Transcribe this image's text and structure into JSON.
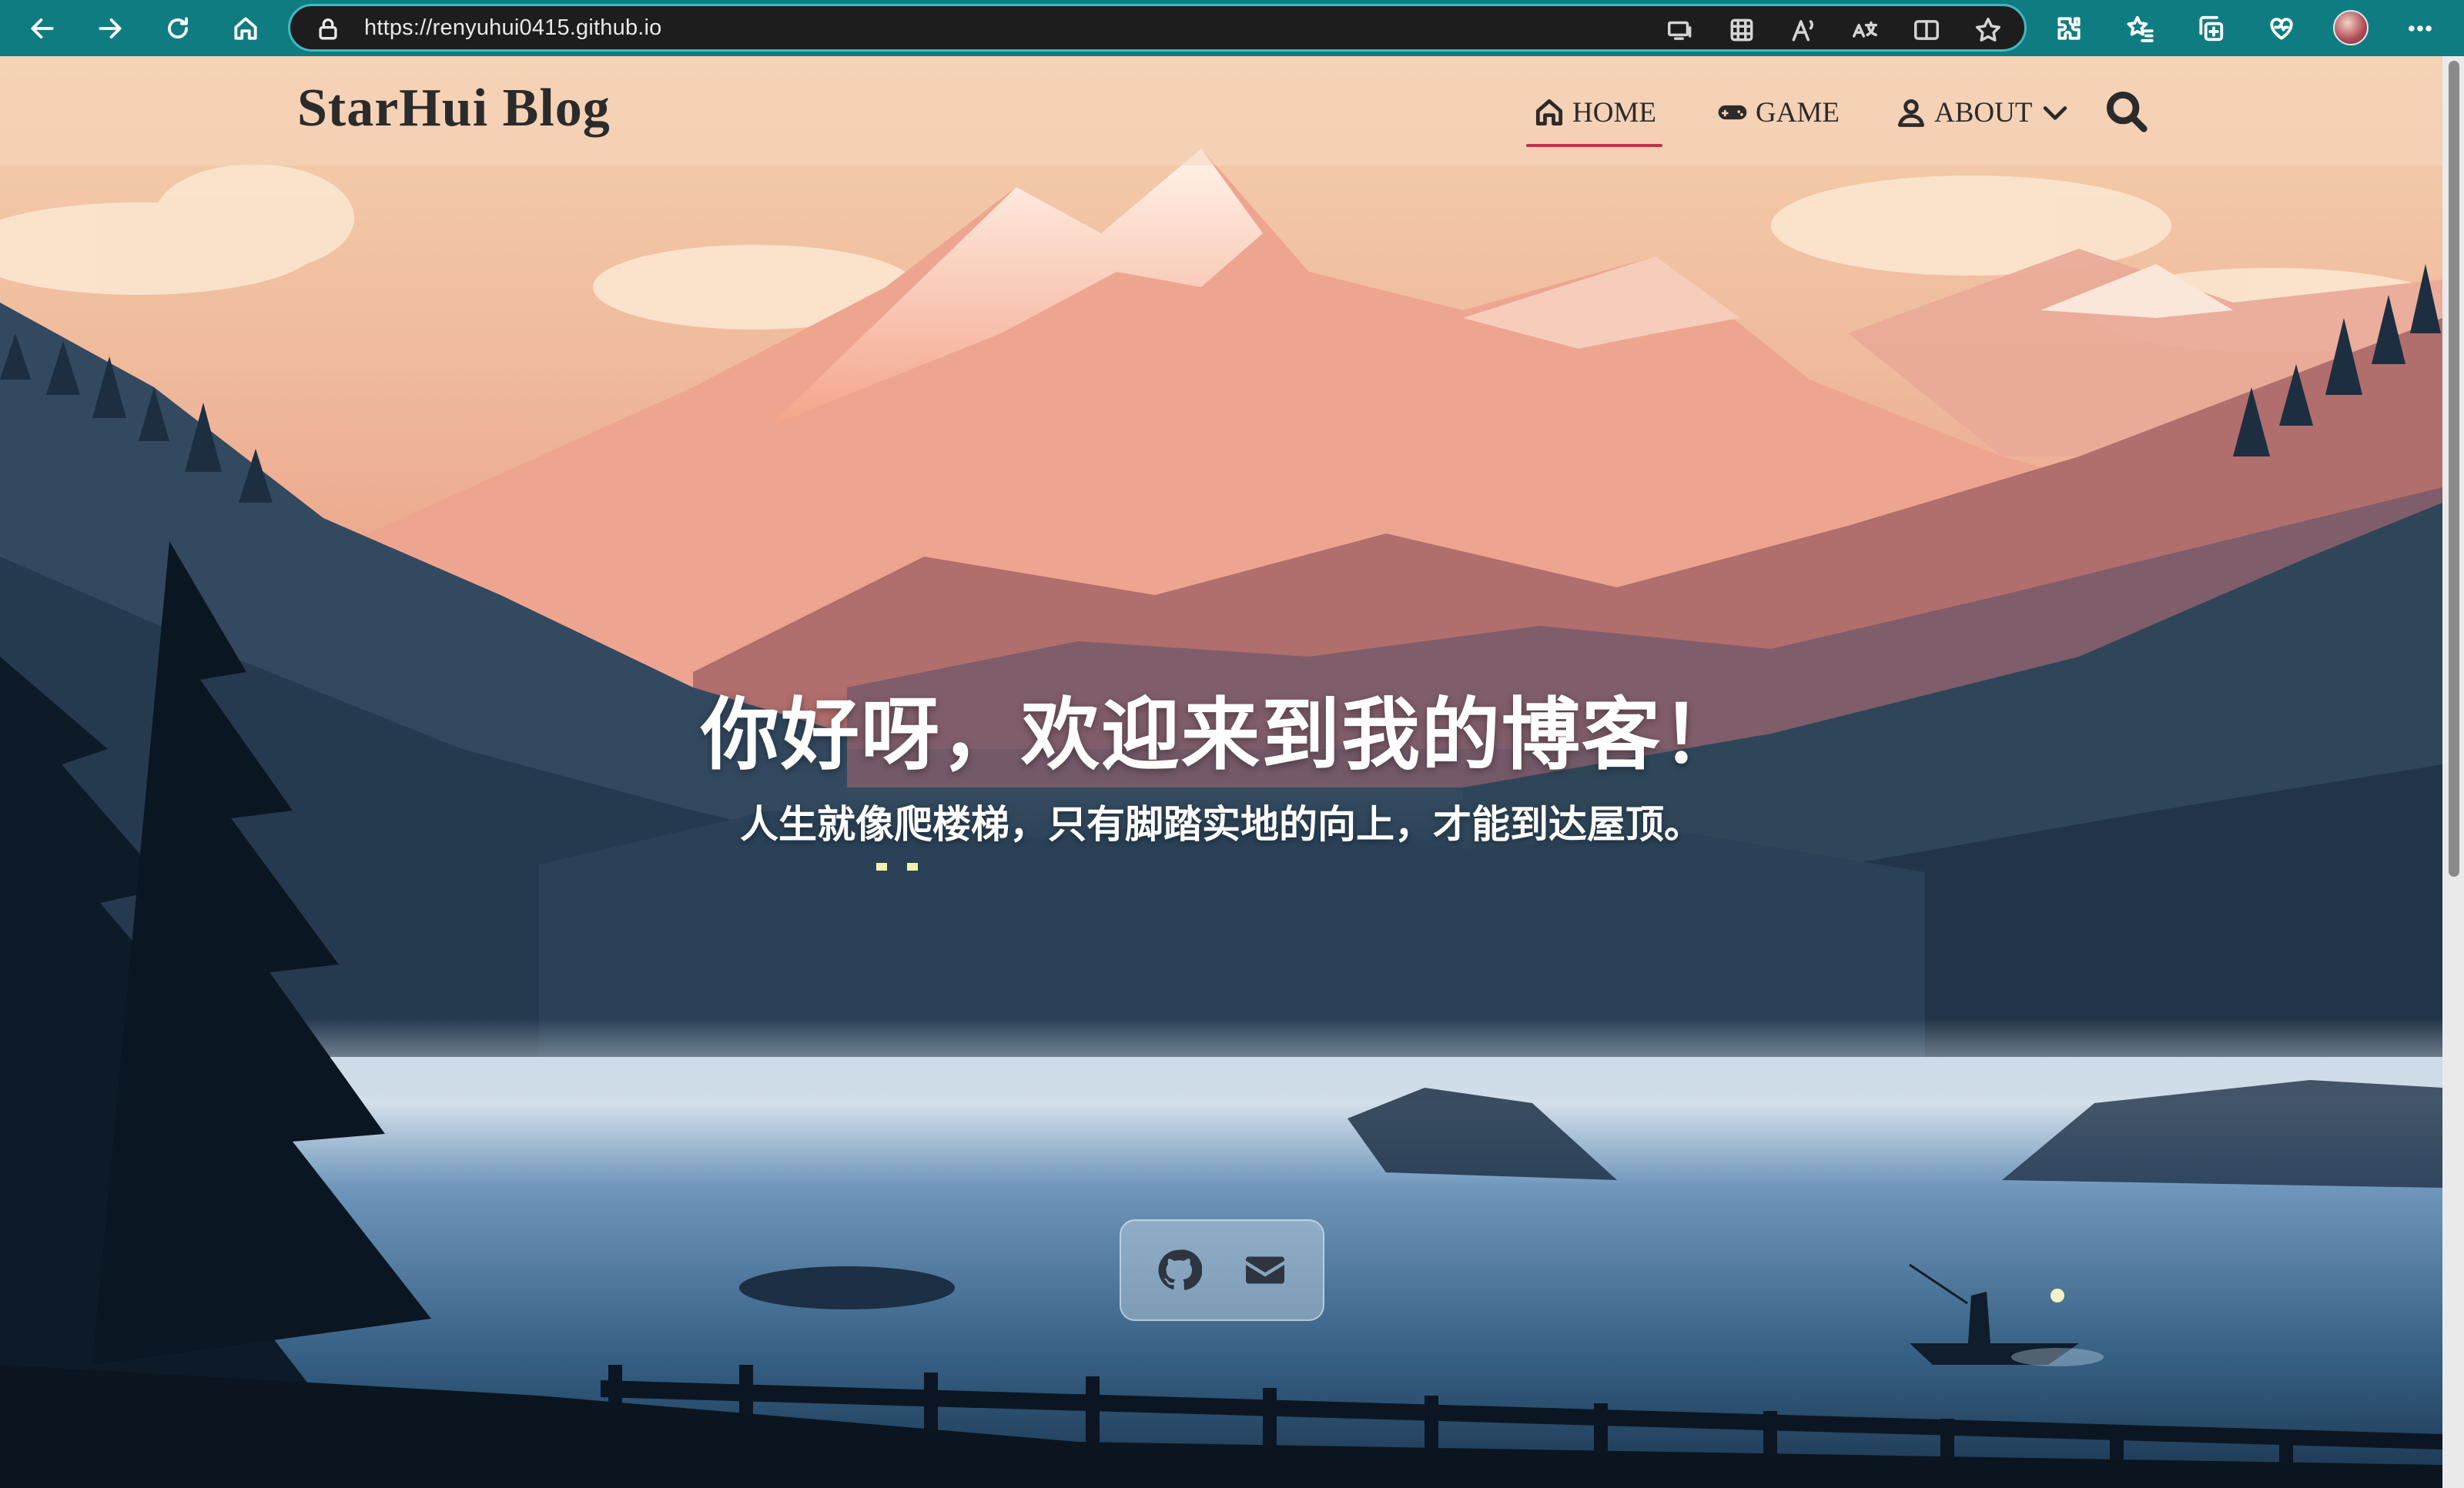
{
  "browser": {
    "url": "https://renyuhui0415.github.io",
    "toolbar_icons": [
      "back-icon",
      "forward-icon",
      "refresh-icon",
      "home-icon"
    ],
    "address_icons": [
      "lock-icon",
      "cast-icon",
      "apps-icon",
      "read-aloud-icon",
      "translate-icon",
      "split-screen-icon",
      "favorite-star-icon"
    ],
    "right_icons": [
      "extensions-icon",
      "favorites-icon",
      "collections-icon",
      "health-icon",
      "profile-avatar",
      "more-icon"
    ],
    "accent": "#0f7c81"
  },
  "site": {
    "brand": "StarHui Blog",
    "nav": {
      "home": "HOME",
      "game": "GAME",
      "about": "ABOUT"
    },
    "active_nav": "HOME",
    "underline_color": "#c0334a"
  },
  "hero": {
    "title": "你好呀，欢迎来到我的博客！",
    "subtitle": "人生就像爬楼梯，只有脚踏实地的向上，才能到达屋顶。"
  },
  "social": {
    "links": [
      "github-icon",
      "email-icon"
    ]
  }
}
